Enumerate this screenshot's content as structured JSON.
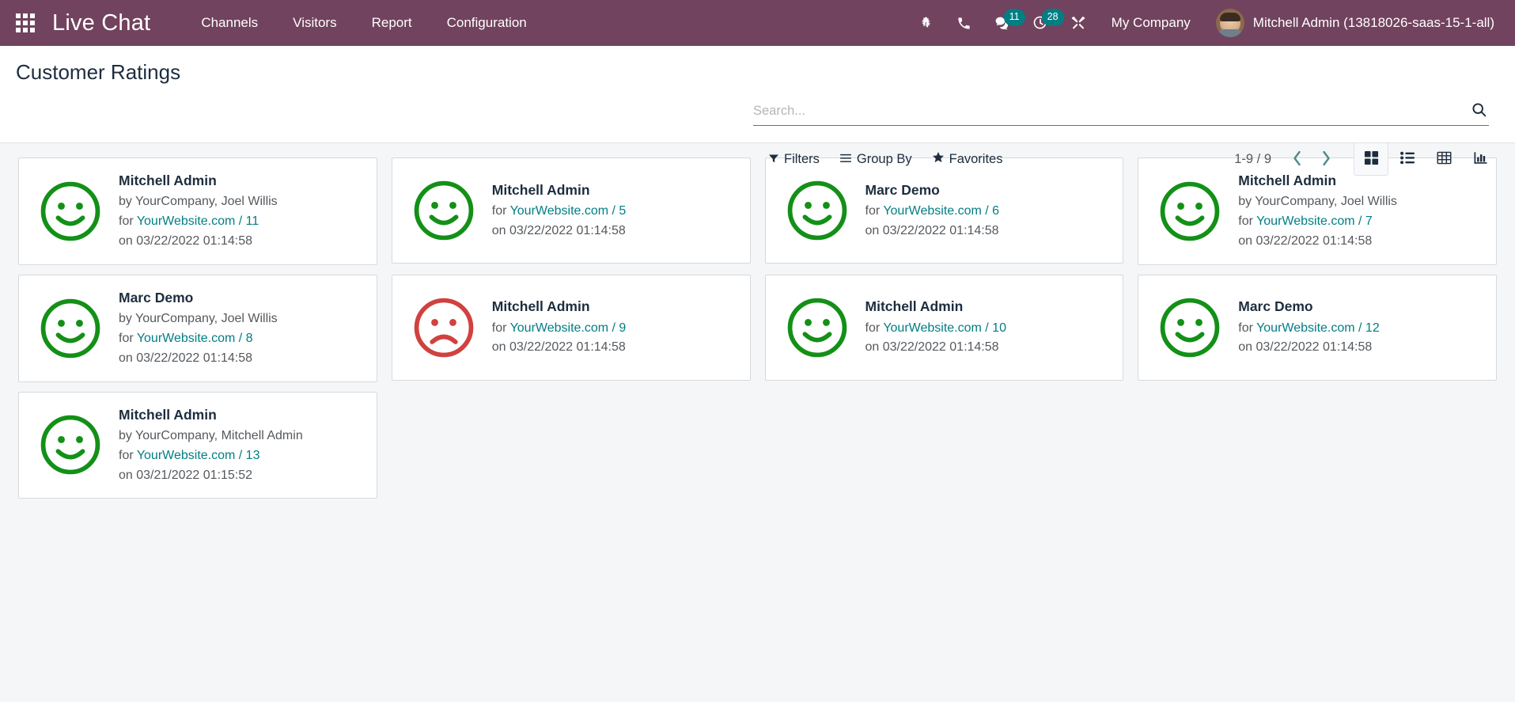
{
  "navbar": {
    "apps_icon": "apps-grid-icon",
    "brand": "Live Chat",
    "menu": [
      {
        "label": "Channels"
      },
      {
        "label": "Visitors"
      },
      {
        "label": "Report"
      },
      {
        "label": "Configuration"
      }
    ],
    "sys_icons": [
      {
        "name": "bug-icon",
        "badge": ""
      },
      {
        "name": "phone-icon",
        "badge": ""
      },
      {
        "name": "messages-icon",
        "badge": "11"
      },
      {
        "name": "activities-clock-icon",
        "badge": "28"
      },
      {
        "name": "tools-icon",
        "badge": ""
      }
    ],
    "company": "My Company",
    "user": "Mitchell Admin (13818026-saas-15-1-all)",
    "background_color": "#71435e",
    "badge_color": "#017e84"
  },
  "control_panel": {
    "title": "Customer Ratings",
    "search": {
      "placeholder": "Search...",
      "value": "",
      "icon": "search-icon"
    },
    "buttons": [
      {
        "label": "Filters",
        "icon": "filter-icon"
      },
      {
        "label": "Group By",
        "icon": "bars-icon"
      },
      {
        "label": "Favorites",
        "icon": "star-icon"
      }
    ],
    "pager": {
      "value": "1-9 / 9",
      "previous_icon": "chevron-left-icon",
      "next_icon": "chevron-right-icon"
    },
    "views": [
      {
        "name": "kanban",
        "icon": "kanban-icon",
        "active": true
      },
      {
        "name": "list",
        "icon": "list-icon",
        "active": false
      },
      {
        "name": "pivot",
        "icon": "pivot-table-icon",
        "active": false
      },
      {
        "name": "graph",
        "icon": "bar-chart-icon",
        "active": false
      }
    ],
    "accent_color": "#00a09d"
  },
  "kanban": {
    "cards": [
      {
        "rating": "happy",
        "face_color": "#139017",
        "title": "Mitchell Admin",
        "by": "by YourCompany, Joel Willis",
        "for_prefix": "for ",
        "for_link": "YourWebsite.com / 11",
        "on": "on 03/22/2022 01:14:58"
      },
      {
        "rating": "happy",
        "face_color": "#139017",
        "title": "Mitchell Admin",
        "by": "",
        "for_prefix": "for ",
        "for_link": "YourWebsite.com / 5",
        "on": "on 03/22/2022 01:14:58"
      },
      {
        "rating": "happy",
        "face_color": "#139017",
        "title": "Marc Demo",
        "by": "",
        "for_prefix": "for ",
        "for_link": "YourWebsite.com / 6",
        "on": "on 03/22/2022 01:14:58"
      },
      {
        "rating": "happy",
        "face_color": "#139017",
        "title": "Mitchell Admin",
        "by": "by YourCompany, Joel Willis",
        "for_prefix": "for ",
        "for_link": "YourWebsite.com / 7",
        "on": "on 03/22/2022 01:14:58"
      },
      {
        "rating": "happy",
        "face_color": "#139017",
        "title": "Marc Demo",
        "by": "by YourCompany, Joel Willis",
        "for_prefix": "for ",
        "for_link": "YourWebsite.com / 8",
        "on": "on 03/22/2022 01:14:58"
      },
      {
        "rating": "sad",
        "face_color": "#d0413f",
        "title": "Mitchell Admin",
        "by": "",
        "for_prefix": "for ",
        "for_link": "YourWebsite.com / 9",
        "on": "on 03/22/2022 01:14:58"
      },
      {
        "rating": "happy",
        "face_color": "#139017",
        "title": "Mitchell Admin",
        "by": "",
        "for_prefix": "for ",
        "for_link": "YourWebsite.com / 10",
        "on": "on 03/22/2022 01:14:58"
      },
      {
        "rating": "happy",
        "face_color": "#139017",
        "title": "Marc Demo",
        "by": "",
        "for_prefix": "for ",
        "for_link": "YourWebsite.com / 12",
        "on": "on 03/22/2022 01:14:58"
      },
      {
        "rating": "happy",
        "face_color": "#139017",
        "title": "Mitchell Admin",
        "by": "by YourCompany, Mitchell Admin",
        "for_prefix": "for ",
        "for_link": "YourWebsite.com / 13",
        "on": "on 03/21/2022 01:15:52"
      }
    ]
  }
}
